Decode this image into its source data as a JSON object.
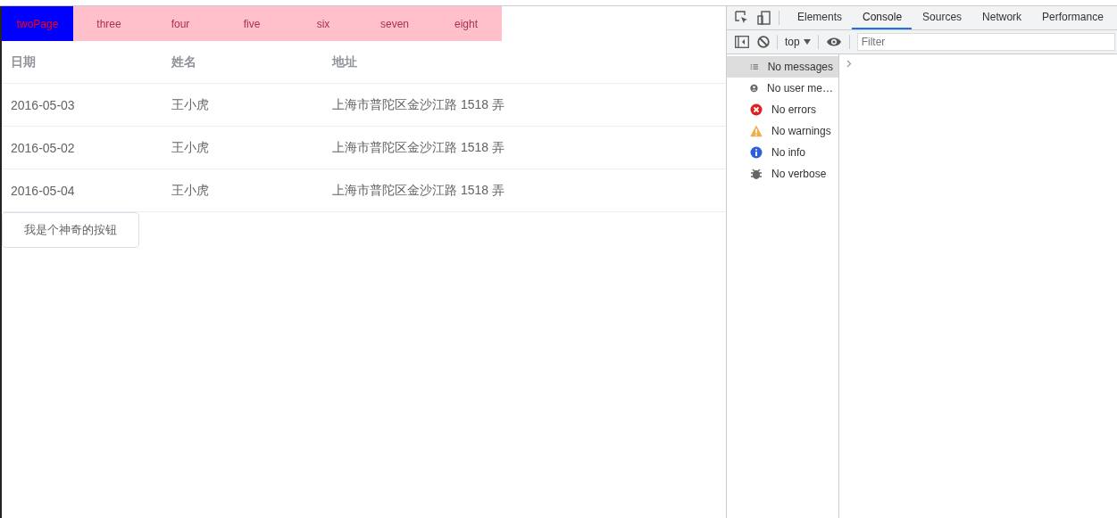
{
  "nav": {
    "tabs": [
      {
        "label": "twoPage",
        "selected": true
      },
      {
        "label": "three",
        "selected": false
      },
      {
        "label": "four",
        "selected": false
      },
      {
        "label": "five",
        "selected": false
      },
      {
        "label": "six",
        "selected": false
      },
      {
        "label": "seven",
        "selected": false
      },
      {
        "label": "eight",
        "selected": false
      }
    ]
  },
  "table": {
    "columns": [
      "日期",
      "姓名",
      "地址"
    ],
    "rows": [
      [
        "2016-05-03",
        "王小虎",
        "上海市普陀区金沙江路 1518 弄"
      ],
      [
        "2016-05-02",
        "王小虎",
        "上海市普陀区金沙江路 1518 弄"
      ],
      [
        "2016-05-04",
        "王小虎",
        "上海市普陀区金沙江路 1518 弄"
      ]
    ]
  },
  "button": {
    "label": "我是个神奇的按钮"
  },
  "devtools": {
    "tabs": [
      {
        "label": "Elements",
        "selected": false
      },
      {
        "label": "Console",
        "selected": true
      },
      {
        "label": "Sources",
        "selected": false
      },
      {
        "label": "Network",
        "selected": false
      },
      {
        "label": "Performance",
        "selected": false
      }
    ],
    "context": "top",
    "filter": {
      "placeholder": "Filter"
    },
    "sidebar": [
      {
        "kind": "messages",
        "label": "No messages",
        "selected": true
      },
      {
        "kind": "user",
        "label": "No user me…",
        "selected": false
      },
      {
        "kind": "errors",
        "label": "No errors",
        "selected": false
      },
      {
        "kind": "warnings",
        "label": "No warnings",
        "selected": false
      },
      {
        "kind": "info",
        "label": "No info",
        "selected": false
      },
      {
        "kind": "verbose",
        "label": "No verbose",
        "selected": false
      }
    ]
  }
}
